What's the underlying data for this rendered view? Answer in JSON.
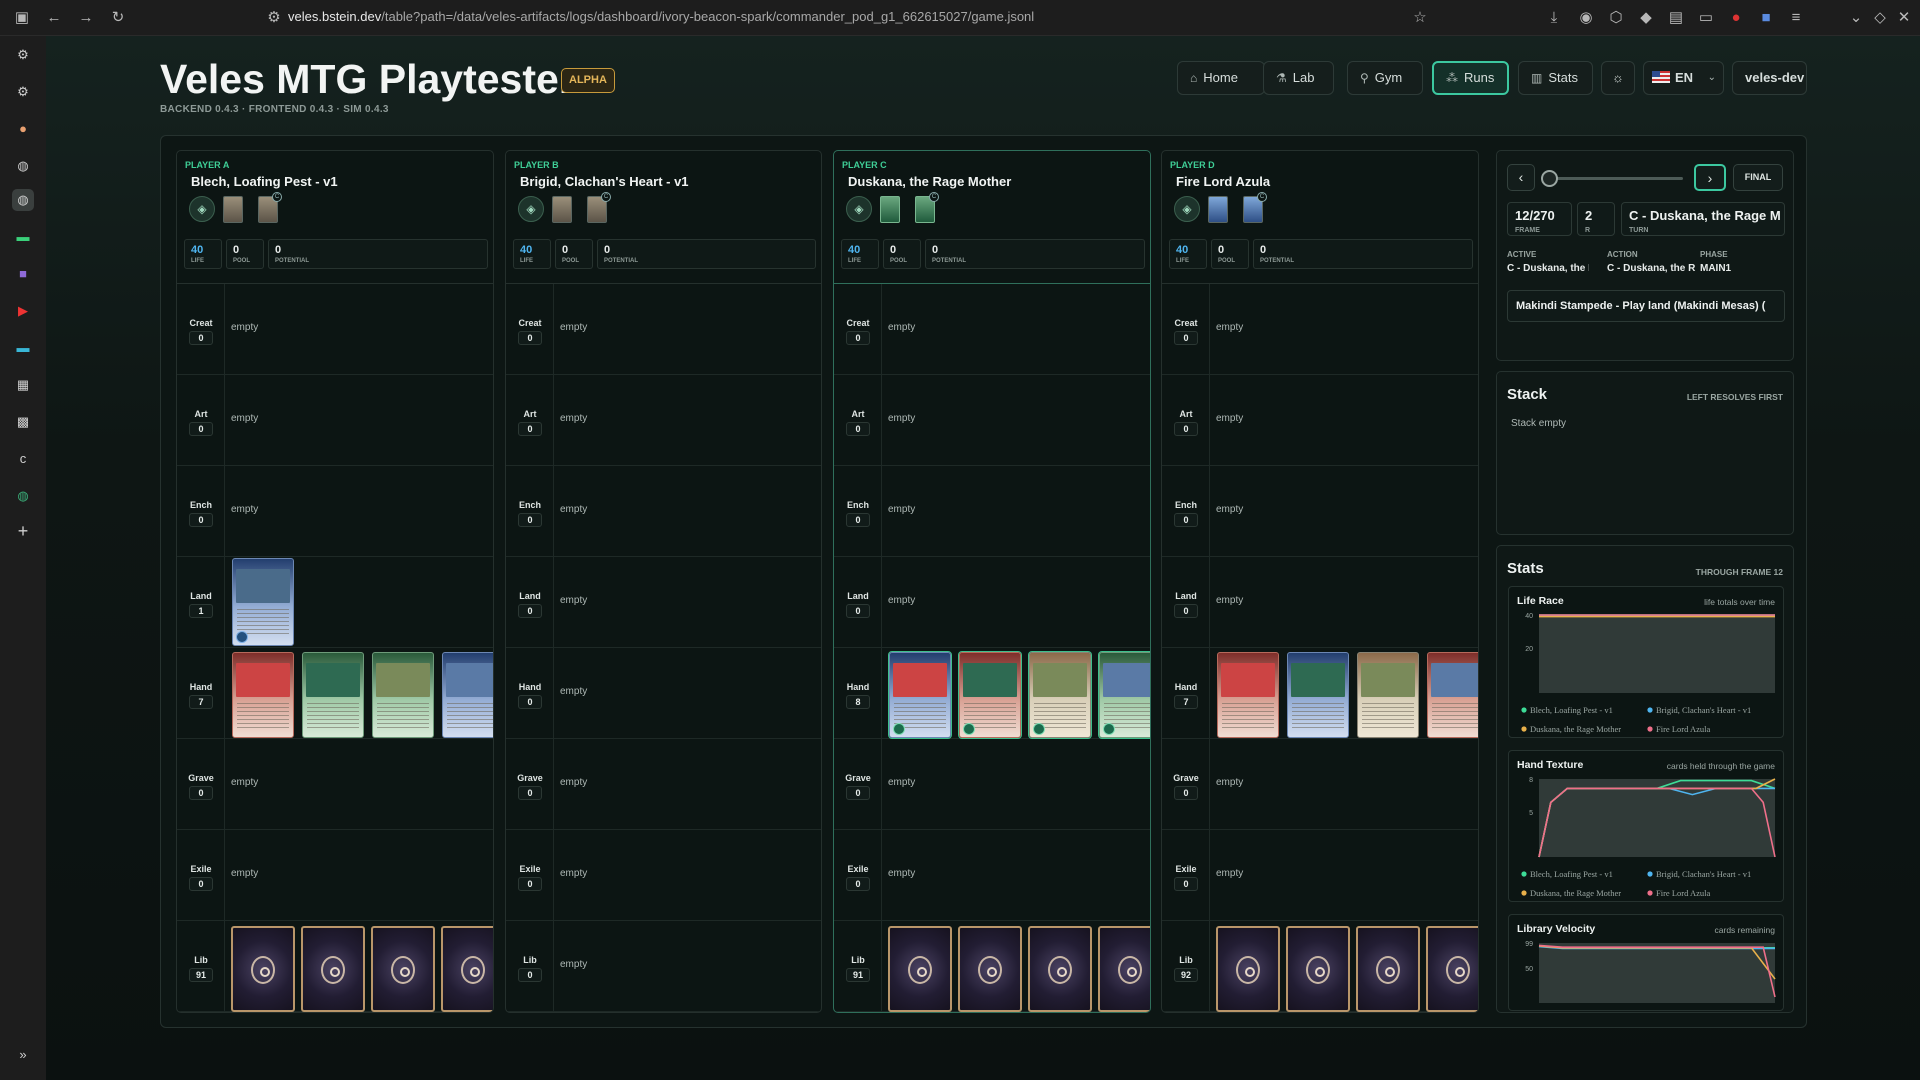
{
  "browser": {
    "url_host": "veles.bstein.dev",
    "url_path": "/table?path=/data/veles-artifacts/logs/dashboard/ivory-beacon-spark/commander_pod_g1_662615027/game.jsonl"
  },
  "app": {
    "title": "Veles MTG Playtester",
    "badge": "ALPHA",
    "version": "BACKEND 0.4.3 · FRONTEND 0.4.3 · SIM 0.4.3"
  },
  "nav": {
    "home": "Home",
    "lab": "Lab",
    "gym": "Gym",
    "runs": "Runs",
    "stats": "Stats",
    "lang": "EN",
    "user": "veles-dev"
  },
  "zone_labels": [
    "Creat",
    "Art",
    "Ench",
    "Land",
    "Hand",
    "Grave",
    "Exile",
    "Lib"
  ],
  "empty_text": "empty",
  "stat_labels": {
    "life": "LIFE",
    "pool": "POOL",
    "potential": "POTENTIAL"
  },
  "players": [
    {
      "label": "PLAYER A",
      "name": "Blech, Loafing Pest - v1",
      "life": "40",
      "pool": "0",
      "potential": "0",
      "counts": [
        "0",
        "0",
        "0",
        "1",
        "7",
        "0",
        "0",
        "91"
      ]
    },
    {
      "label": "PLAYER B",
      "name": "Brigid, Clachan's Heart - v1",
      "life": "40",
      "pool": "0",
      "potential": "0",
      "counts": [
        "0",
        "0",
        "0",
        "0",
        "0",
        "0",
        "0",
        "0"
      ]
    },
    {
      "label": "PLAYER C",
      "name": "Duskana, the Rage Mother",
      "life": "40",
      "pool": "0",
      "potential": "0",
      "counts": [
        "0",
        "0",
        "0",
        "0",
        "8",
        "0",
        "0",
        "91"
      ]
    },
    {
      "label": "PLAYER D",
      "name": "Fire Lord Azula",
      "life": "40",
      "pool": "0",
      "potential": "0",
      "counts": [
        "0",
        "0",
        "0",
        "0",
        "7",
        "0",
        "0",
        "92"
      ]
    }
  ],
  "replay": {
    "final": "FINAL",
    "frame": "12/270",
    "frame_label": "FRAME",
    "round": "2",
    "round_label": "R",
    "turn": "C - Duskana, the Rage M",
    "turn_label": "TURN",
    "slider_fraction": 0.044,
    "active_label": "ACTIVE",
    "active": "C - Duskana, the F",
    "action_label": "ACTION",
    "action": "C - Duskana, the R",
    "phase_label": "PHASE",
    "phase": "MAIN1",
    "event": "Makindi Stampede - Play land (Makindi Mesas) ("
  },
  "stack": {
    "title": "Stack",
    "hint": "LEFT RESOLVES FIRST",
    "empty": "Stack empty"
  },
  "stats": {
    "title": "Stats",
    "hint": "THROUGH FRAME 12"
  },
  "charts": {
    "life": {
      "title": "Life Race",
      "subtitle": "life totals over time",
      "y_ticks": [
        "40",
        "20"
      ]
    },
    "hand": {
      "title": "Hand Texture",
      "subtitle": "cards held through the game",
      "y_ticks": [
        "8",
        "5"
      ]
    },
    "library": {
      "title": "Library Velocity",
      "subtitle": "cards remaining",
      "y_ticks": [
        "99",
        "50"
      ]
    },
    "legend": [
      "Blech, Loafing Pest - v1",
      "Brigid, Clachan's Heart - v1",
      "Duskana, the Rage Mother",
      "Fire Lord Azula"
    ],
    "colors": [
      "#3ddc97",
      "#4fb5f0",
      "#e8b04a",
      "#ef6f8a"
    ]
  }
}
